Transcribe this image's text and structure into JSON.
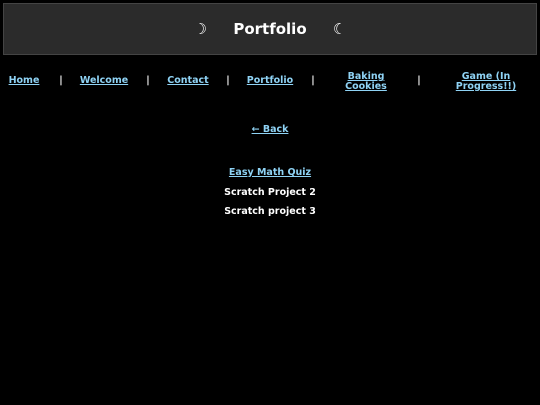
{
  "header": {
    "title": "Portfolio",
    "left_icon": "☽",
    "right_icon": "☾"
  },
  "nav": {
    "items": [
      {
        "label": "Home"
      },
      {
        "label": "Welcome"
      },
      {
        "label": "Contact"
      },
      {
        "label": "Portfolio"
      },
      {
        "label": "Baking Cookies"
      },
      {
        "label": "Game (In Progress!!)"
      }
    ],
    "separator": "|"
  },
  "back_link": "← Back",
  "projects": [
    {
      "label": "Easy Math Quiz",
      "is_link": true
    },
    {
      "label": "Scratch Project 2",
      "is_link": false
    },
    {
      "label": "Scratch project 3",
      "is_link": false
    }
  ],
  "colors": {
    "background": "#000000",
    "header_bg": "#2b2b2b",
    "link": "#8fd3f5",
    "text": "#ffffff"
  }
}
